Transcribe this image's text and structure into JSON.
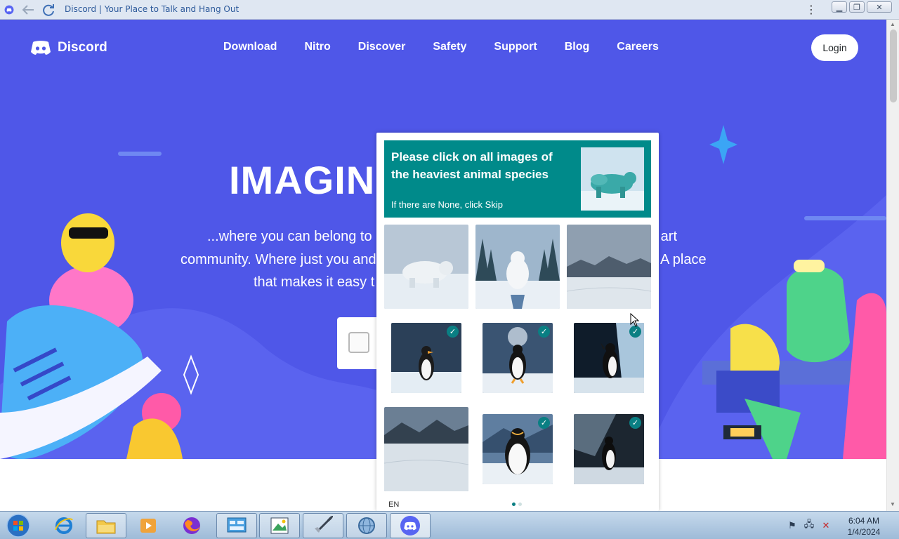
{
  "browser": {
    "tab_title": "Discord | Your Place to Talk and Hang Out"
  },
  "nav": {
    "logo_text": "Discord",
    "items": [
      "Download",
      "Nitro",
      "Discover",
      "Safety",
      "Support",
      "Blog",
      "Careers"
    ],
    "login_label": "Login"
  },
  "hero": {
    "headline": "IMAGIN",
    "line1_left": "...where you can belong to a",
    "line1_right": "e art",
    "line2_left": "community. Where just you and",
    "line2_right": "A place",
    "line3_left": "that makes it easy t"
  },
  "captcha": {
    "prompt": "Please click on all images of the heaviest animal species",
    "sub": "If there are None, click Skip",
    "language": "EN",
    "tiles": [
      {
        "subject": "polar-bear",
        "selected": false
      },
      {
        "subject": "polar-bear",
        "selected": false
      },
      {
        "subject": "landscape",
        "selected": false
      },
      {
        "subject": "penguin",
        "selected": true
      },
      {
        "subject": "penguin",
        "selected": true
      },
      {
        "subject": "penguin",
        "selected": true
      },
      {
        "subject": "landscape",
        "selected": false
      },
      {
        "subject": "penguin",
        "selected": true
      },
      {
        "subject": "penguin",
        "selected": true
      }
    ],
    "check_glyph": "✓",
    "accent_color": "#008a8a"
  },
  "taskbar": {
    "time": "6:04 AM",
    "date": "1/4/2024"
  },
  "colors": {
    "hero_bg": "#4f57e8",
    "taskbar": "#b3cbe3"
  }
}
